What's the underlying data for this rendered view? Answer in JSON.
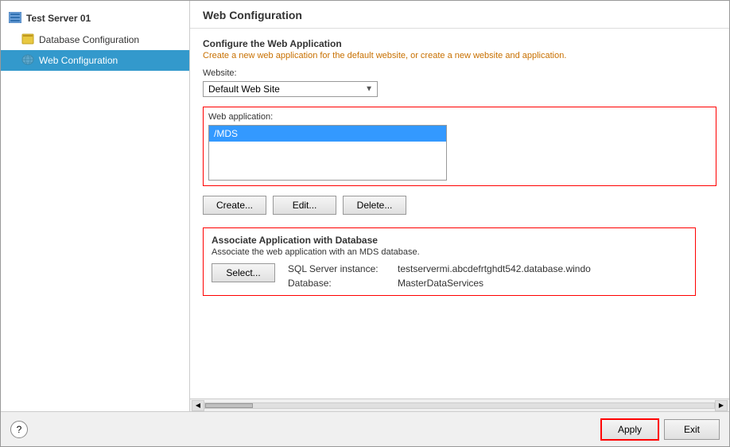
{
  "sidebar": {
    "server_name": "Test Server 01",
    "items": [
      {
        "id": "database-config",
        "label": "Database Configuration",
        "icon": "database-icon",
        "active": false
      },
      {
        "id": "web-config",
        "label": "Web Configuration",
        "icon": "web-icon",
        "active": true
      }
    ]
  },
  "panel": {
    "title": "Web Configuration",
    "section1": {
      "title": "Configure the Web Application",
      "description": "Create a new web application for the default website, or create a new website and application.",
      "website_label": "Website:",
      "website_options": [
        "Default Web Site"
      ],
      "website_selected": "Default Web Site",
      "webapp_label": "Web application:",
      "webapp_items": [
        "/MDS"
      ],
      "webapp_selected": "/MDS"
    },
    "buttons": {
      "create": "Create...",
      "edit": "Edit...",
      "delete": "Delete..."
    },
    "section2": {
      "title": "Associate Application with Database",
      "description": "Associate the web application with an MDS database.",
      "select_btn": "Select...",
      "sql_server_label": "SQL Server instance:",
      "sql_server_value": "testservermi.abcdefrtghdt542.database.windo",
      "database_label": "Database:",
      "database_value": "MasterDataServices"
    }
  },
  "footer": {
    "help_label": "?",
    "apply_label": "Apply",
    "exit_label": "Exit"
  }
}
